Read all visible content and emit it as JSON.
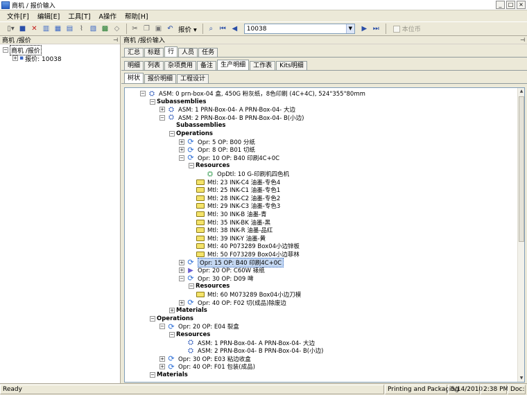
{
  "window": {
    "title": "商机 / 报价输入",
    "controls": [
      "_",
      "□",
      "×"
    ]
  },
  "menu": [
    "文件[F]",
    "编辑[E]",
    "工具[T]",
    "A操作",
    "帮助[H]"
  ],
  "toolbar": {
    "quote_label": "报价 ▾",
    "search_value": "10038",
    "base_currency_label": "本位币"
  },
  "left_pane": {
    "title": "商机 /报价",
    "tree": [
      {
        "label": "商机 /报价",
        "selected": true
      },
      {
        "label": "报价: 10038"
      }
    ]
  },
  "right_pane": {
    "title": "商机 /报价输入",
    "tabs_row1": [
      "汇总",
      "标题",
      "行",
      "人员",
      "任务"
    ],
    "tabs_row1_active": 2,
    "tabs_row2": [
      "明细",
      "列表",
      "杂项费用",
      "备注",
      "生产明细",
      "工作表",
      "Kits明细"
    ],
    "tabs_row2_active": 4,
    "tabs_row3": [
      "树状",
      "报价明细",
      "工程设计"
    ],
    "tabs_row3_active": 0
  },
  "tree": [
    {
      "level": 0,
      "exp": "-",
      "icon": "asm",
      "label": "ASM: 0 prn-box-04 盒, 450G 粉灰纸，8色印刷 (4C+4C), 524\"355\"80mm"
    },
    {
      "level": 1,
      "exp": "-",
      "icon": "",
      "label": "Subassemblies",
      "section": true
    },
    {
      "level": 2,
      "exp": "+",
      "icon": "asm",
      "label": "ASM: 1 PRN-Box-04- A PRN-Box-04- 大边"
    },
    {
      "level": 2,
      "exp": "-",
      "icon": "asm",
      "label": "ASM: 2 PRN-Box-04- B PRN-Box-04- B(小边)"
    },
    {
      "level": 3,
      "exp": "",
      "icon": "",
      "label": "Subassemblies",
      "section": true
    },
    {
      "level": 3,
      "exp": "-",
      "icon": "",
      "label": "Operations",
      "section": true
    },
    {
      "level": 4,
      "exp": "+",
      "icon": "op",
      "label": "Opr: 5 OP: B00 分纸"
    },
    {
      "level": 4,
      "exp": "+",
      "icon": "op",
      "label": "Opr: 8 OP: B01 切纸"
    },
    {
      "level": 4,
      "exp": "-",
      "icon": "op",
      "label": "Opr: 10 OP: B40 印刷4C+0C"
    },
    {
      "level": 5,
      "exp": "-",
      "icon": "",
      "label": "Resources",
      "section": true
    },
    {
      "level": 6,
      "exp": "",
      "icon": "opdtl",
      "label": "OpDtl: 10 G-印刷机四色机"
    },
    {
      "level": 5,
      "exp": "",
      "icon": "mtl",
      "label": "Mtl: 23 INK-C4 油墨-专色4"
    },
    {
      "level": 5,
      "exp": "",
      "icon": "mtl",
      "label": "Mtl: 25 INK-C1 油墨-专色1"
    },
    {
      "level": 5,
      "exp": "",
      "icon": "mtl",
      "label": "Mtl: 28 INK-C2 油墨-专色2"
    },
    {
      "level": 5,
      "exp": "",
      "icon": "mtl",
      "label": "Mtl: 29 INK-C3 油墨-专色3"
    },
    {
      "level": 5,
      "exp": "",
      "icon": "mtl",
      "label": "Mtl: 30 INK-B 油墨-青"
    },
    {
      "level": 5,
      "exp": "",
      "icon": "mtl",
      "label": "Mtl: 35 INK-BK 油墨-黑"
    },
    {
      "level": 5,
      "exp": "",
      "icon": "mtl",
      "label": "Mtl: 38 INK-R 油墨-品红"
    },
    {
      "level": 5,
      "exp": "",
      "icon": "mtl",
      "label": "Mtl: 39 INK-Y 油墨-黄"
    },
    {
      "level": 5,
      "exp": "",
      "icon": "mtl",
      "label": "Mtl: 40 P073289 Box04小边锌板"
    },
    {
      "level": 5,
      "exp": "",
      "icon": "mtl",
      "label": "Mtl: 50 F073289 Box04小边菲林"
    },
    {
      "level": 4,
      "exp": "+",
      "icon": "op",
      "label": "Opr: 15 OP: B40 印刷4C+0C",
      "selected": true
    },
    {
      "level": 4,
      "exp": "+",
      "icon": "ds",
      "label": "Opr: 20 OP: C60W 裱纸"
    },
    {
      "level": 4,
      "exp": "-",
      "icon": "op",
      "label": "Opr: 30 OP: D09 啤"
    },
    {
      "level": 5,
      "exp": "-",
      "icon": "",
      "label": "Resources",
      "section": true
    },
    {
      "level": 5,
      "exp": "",
      "icon": "mtl",
      "label": "Mtl: 60 M073289 Box04小边刀模"
    },
    {
      "level": 4,
      "exp": "+",
      "icon": "op",
      "label": "Opr: 40 OP: F02 切(成品)除废边"
    },
    {
      "level": 3,
      "exp": "+",
      "icon": "",
      "label": "Materials",
      "section": true
    },
    {
      "level": 1,
      "exp": "-",
      "icon": "",
      "label": "Operations",
      "section": true
    },
    {
      "level": 2,
      "exp": "-",
      "icon": "op",
      "label": "Opr: 20 OP: E04 裂盒"
    },
    {
      "level": 3,
      "exp": "-",
      "icon": "",
      "label": "Resources",
      "section": true
    },
    {
      "level": 4,
      "exp": "",
      "icon": "asm",
      "label": "ASM: 1 PRN-Box-04- A PRN-Box-04- 大边"
    },
    {
      "level": 4,
      "exp": "",
      "icon": "asm",
      "label": "ASM: 2 PRN-Box-04- B PRN-Box-04- B(小边)"
    },
    {
      "level": 2,
      "exp": "+",
      "icon": "op",
      "label": "Opr: 30 OP: E03 粘边收盒"
    },
    {
      "level": 2,
      "exp": "+",
      "icon": "op",
      "label": "Opr: 40 OP: F01 包装(成品)"
    },
    {
      "level": 1,
      "exp": "-",
      "icon": "",
      "label": "Materials",
      "section": true
    }
  ],
  "status": {
    "ready": "Ready",
    "company": "Printing and Packaging",
    "date": "5/14/2010",
    "time": "2:38 PM",
    "doc": "Doc:"
  }
}
